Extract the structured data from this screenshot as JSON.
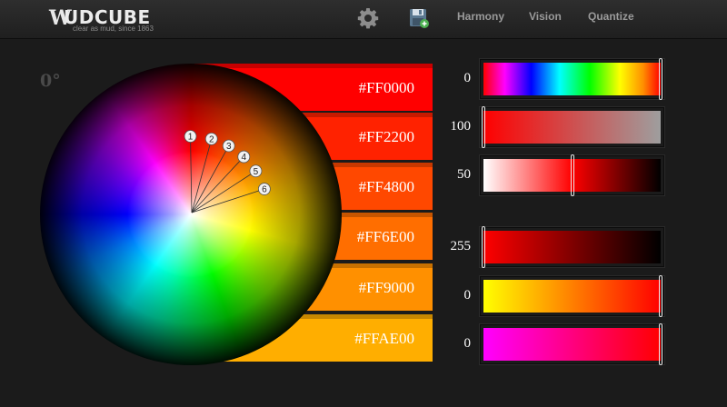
{
  "header": {
    "logo_mark": "W",
    "logo_text": "UDCUBE",
    "tagline": "clear as mud, since 1863",
    "nav": [
      "Harmony",
      "Vision",
      "Quantize"
    ],
    "icons": [
      "gear-icon",
      "save-icon"
    ]
  },
  "wheel": {
    "angle": "0°",
    "markers": [
      {
        "label": "1",
        "hex": "#FF0000"
      },
      {
        "label": "2",
        "hex": "#FF2200"
      },
      {
        "label": "3",
        "hex": "#FF4800"
      },
      {
        "label": "4",
        "hex": "#FF6E00"
      },
      {
        "label": "5",
        "hex": "#FF9000"
      },
      {
        "label": "6",
        "hex": "#FFAE00"
      }
    ]
  },
  "swatches": [
    {
      "hex": "#FF0000",
      "color": "#ff0000"
    },
    {
      "hex": "#FF2200",
      "color": "#ff2200"
    },
    {
      "hex": "#FF4800",
      "color": "#ff4800"
    },
    {
      "hex": "#FF6E00",
      "color": "#ff6e00"
    },
    {
      "hex": "#FF9000",
      "color": "#ff9000"
    },
    {
      "hex": "#FFAE00",
      "color": "#ffae00"
    }
  ],
  "sliders": [
    {
      "label": "0",
      "fraction": 1.0
    },
    {
      "label": "100",
      "fraction": 0.0
    },
    {
      "label": "50",
      "fraction": 0.5
    },
    {
      "label": "255",
      "fraction": 0.0
    },
    {
      "label": "0",
      "fraction": 1.0
    },
    {
      "label": "0",
      "fraction": 1.0
    }
  ]
}
